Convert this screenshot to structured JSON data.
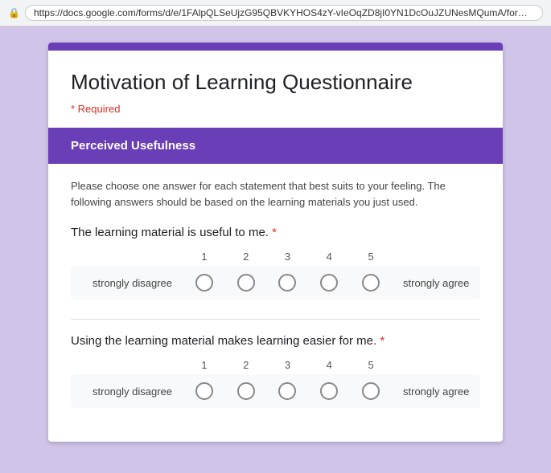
{
  "browser": {
    "url": "https://docs.google.com/forms/d/e/1FAlpQLSeUjzG95QBVKYHOS4zY-vIeOqZD8jI0YN1DcOuJZUNesMQumA/formRespe"
  },
  "form": {
    "title": "Motivation of Learning Questionnaire",
    "required_note": "* Required",
    "section": {
      "title": "Perceived Usefulness",
      "instruction": "Please choose one answer for each statement that best suits to your feeling. The following answers should be based on the learning materials you just used."
    },
    "questions": [
      {
        "id": 1,
        "text": "The learning material is useful to me.",
        "required": true,
        "scale": {
          "min_label": "strongly disagree",
          "max_label": "strongly agree",
          "points": [
            "1",
            "2",
            "3",
            "4",
            "5"
          ]
        }
      },
      {
        "id": 2,
        "text": "Using the learning material makes learning easier for me.",
        "required": true,
        "scale": {
          "min_label": "strongly disagree",
          "max_label": "strongly agree",
          "points": [
            "1",
            "2",
            "3",
            "4",
            "5"
          ]
        }
      }
    ]
  }
}
